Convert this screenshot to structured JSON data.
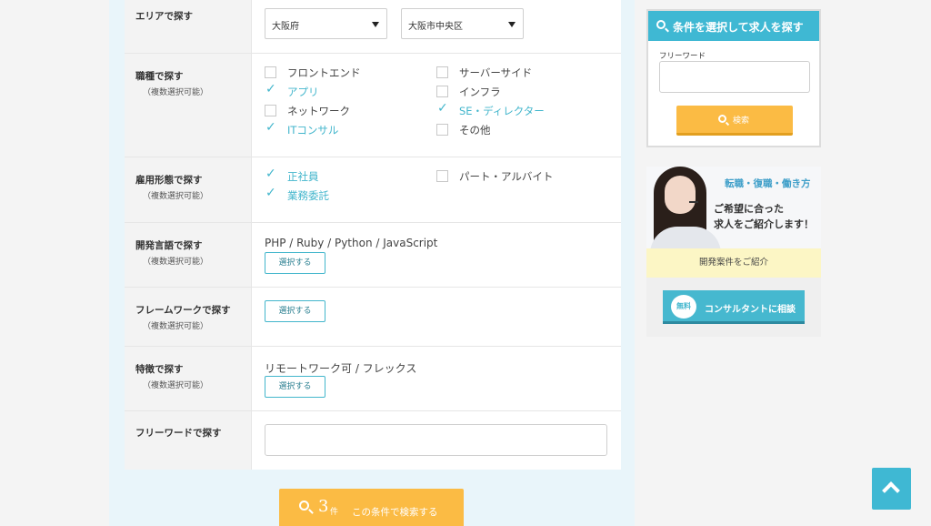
{
  "area": {
    "label": "エリアで探す",
    "prefecture": "大阪府",
    "city": "大阪市中央区"
  },
  "job_type": {
    "label": "職種で探す",
    "sub": "（複数選択可能）",
    "options": [
      {
        "text": "フロントエンド",
        "checked": false
      },
      {
        "text": "サーバーサイド",
        "checked": false
      },
      {
        "text": "アプリ",
        "checked": true
      },
      {
        "text": "インフラ",
        "checked": false
      },
      {
        "text": "ネットワーク",
        "checked": false
      },
      {
        "text": "SE・ディレクター",
        "checked": true
      },
      {
        "text": "ITコンサル",
        "checked": true
      },
      {
        "text": "その他",
        "checked": false
      }
    ]
  },
  "employment": {
    "label": "雇用形態で探す",
    "sub": "（複数選択可能）",
    "options": [
      {
        "text": "正社員",
        "checked": true
      },
      {
        "text": "パート・アルバイト",
        "checked": false
      },
      {
        "text": "業務委託",
        "checked": true
      }
    ]
  },
  "language": {
    "label": "開発言語で探す",
    "sub": "（複数選択可能）",
    "selected": "PHP / Ruby / Python / JavaScript",
    "button": "選択する"
  },
  "framework": {
    "label": "フレームワークで探す",
    "sub": "（複数選択可能）",
    "button": "選択する"
  },
  "feature": {
    "label": "特徴で探す",
    "sub": "（複数選択可能）",
    "selected": "リモートワーク可 / フレックス",
    "button": "選択する"
  },
  "freeword": {
    "label": "フリーワードで探す",
    "value": ""
  },
  "submit": {
    "count": "3",
    "unit": "件",
    "label": "この条件で検索する"
  },
  "sidebar_search": {
    "title": "条件を選択して求人を探す",
    "freeword_label": "フリーワード",
    "button": "検索"
  },
  "banner": {
    "tagline": "転職・復職・働き方",
    "line1": "ご希望に合った",
    "line2": "求人をご紹介します！",
    "strip": "開発案件をご紹介",
    "consult_badge": "無料",
    "consult_label": "コンサルタントに相談"
  },
  "colors": {
    "accent": "#3fb8d3",
    "check": "#43b6cc",
    "button": "#fbbb44"
  },
  "icons": [
    "search-icon",
    "check-icon",
    "chevron-up-icon",
    "dropdown-caret-icon"
  ]
}
